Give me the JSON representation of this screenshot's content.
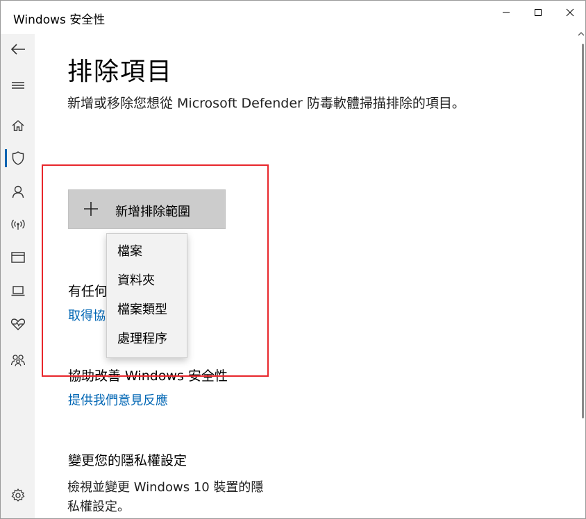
{
  "window": {
    "title": "Windows 安全性"
  },
  "page": {
    "title": "排除項目",
    "description": "新增或移除您想從 Microsoft Defender 防毒軟體掃描排除的項目。"
  },
  "add_exclusion_button": {
    "label": "新增排除範圍"
  },
  "menu": {
    "items": [
      "檔案",
      "資料夾",
      "檔案類型",
      "處理程序"
    ]
  },
  "sections": {
    "question_heading": "有任何問題嗎?",
    "question_link": "取得協助",
    "improve_heading": "協助改善 Windows 安全性",
    "improve_link": "提供我們意見反應",
    "privacy_heading": "變更您的隱私權設定",
    "privacy_text": "檢視並變更 Windows 10 裝置的隱私權設定。"
  },
  "nav_icons": [
    "back-arrow-icon",
    "hamburger-menu-icon",
    "home-icon",
    "shield-icon",
    "account-icon",
    "wireless-icon",
    "app-browser-icon",
    "laptop-icon",
    "heart-health-icon",
    "family-icon",
    "settings-gear-icon"
  ],
  "colors": {
    "accent": "#0063b1",
    "link": "#0066b4",
    "highlight": "#e8262b",
    "nav_bg": "#f2f2f2",
    "button_bg": "#cccccc"
  }
}
